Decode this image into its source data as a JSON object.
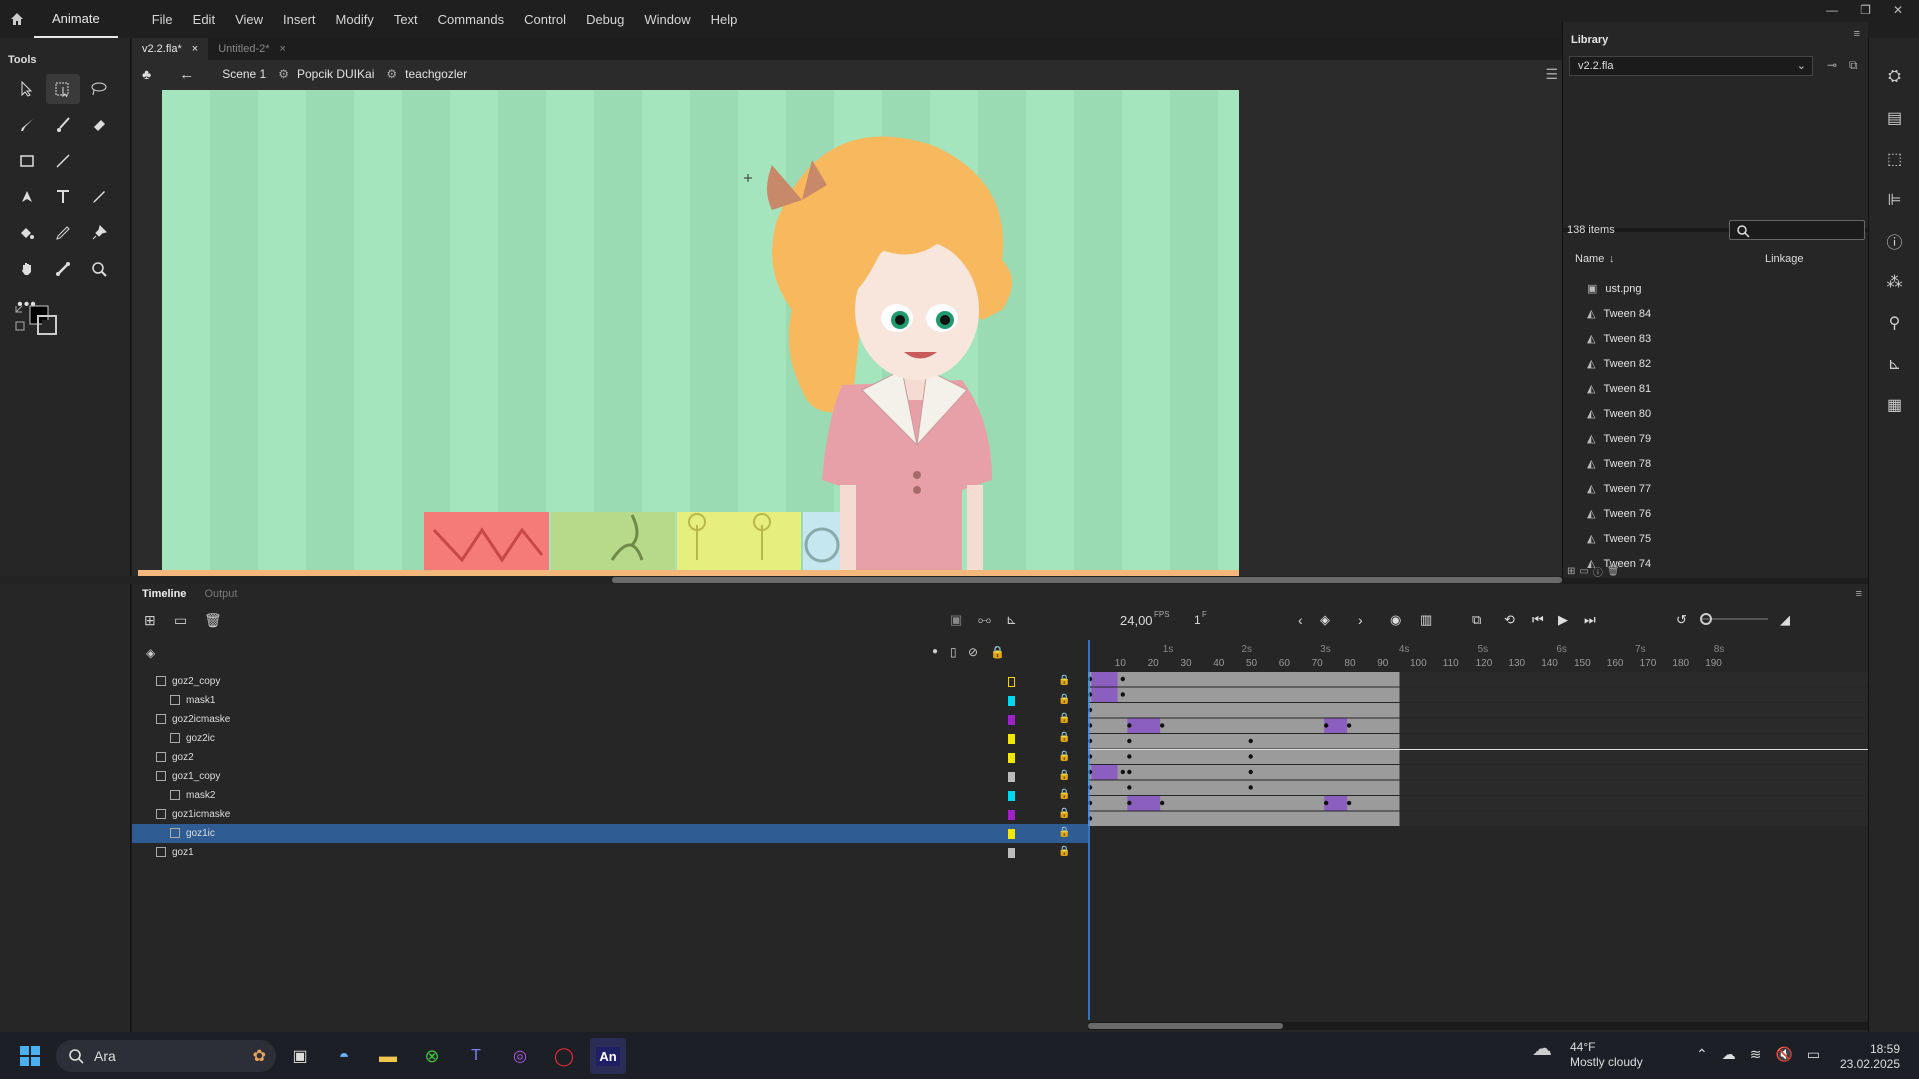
{
  "menubar": {
    "app_name": "Animate",
    "items": [
      "File",
      "Edit",
      "View",
      "Insert",
      "Modify",
      "Text",
      "Commands",
      "Control",
      "Debug",
      "Window",
      "Help"
    ]
  },
  "tools": {
    "title": "Tools"
  },
  "doc_tabs": [
    {
      "label": "v2.2.fla*",
      "active": true
    },
    {
      "label": "Untitled-2*",
      "active": false
    }
  ],
  "breadcrumb": {
    "scene": "Scene 1",
    "symbol1": "Popcik DUIKai",
    "symbol2": "teachgozler"
  },
  "library": {
    "title": "Library",
    "document": "v2.2.fla",
    "count_text": "138 items",
    "col_name": "Name",
    "col_linkage": "Linkage",
    "items": [
      "ust.png",
      "Tween 84",
      "Tween 83",
      "Tween 82",
      "Tween 81",
      "Tween 80",
      "Tween 79",
      "Tween 78",
      "Tween 77",
      "Tween 76",
      "Tween 75",
      "Tween 74"
    ]
  },
  "timeline": {
    "tab_timeline": "Timeline",
    "tab_output": "Output",
    "fps": "24,00",
    "fps_unit": "FPS",
    "current_frame": "1",
    "frame_unit": "F",
    "ruler_frames": [
      "10",
      "20",
      "30",
      "40",
      "50",
      "60",
      "70",
      "80",
      "90",
      "100",
      "110",
      "120",
      "130",
      "140",
      "150",
      "160",
      "170",
      "180",
      "190"
    ],
    "ruler_seconds": [
      "1s",
      "2s",
      "3s",
      "4s",
      "5s",
      "6s",
      "7s",
      "8s"
    ],
    "layers": [
      {
        "name": "goz2_copy",
        "indent": 0,
        "color": "#f0d800",
        "outline": true,
        "selected": false
      },
      {
        "name": "mask1",
        "indent": 1,
        "color": "#00d8f0",
        "selected": false
      },
      {
        "name": "goz2icmaske",
        "indent": 0,
        "color": "#a020c8",
        "selected": false
      },
      {
        "name": "goz2ic",
        "indent": 1,
        "color": "#f0e800",
        "selected": false
      },
      {
        "name": "goz2",
        "indent": 0,
        "color": "#f0e800",
        "selected": false
      },
      {
        "name": "goz1_copy",
        "indent": 0,
        "color": "#bbbbbb",
        "selected": false
      },
      {
        "name": "mask2",
        "indent": 1,
        "color": "#00d8f0",
        "selected": false
      },
      {
        "name": "goz1icmaske",
        "indent": 0,
        "color": "#a020c8",
        "selected": false
      },
      {
        "name": "goz1ic",
        "indent": 1,
        "color": "#f0e800",
        "selected": true
      },
      {
        "name": "goz1",
        "indent": 0,
        "color": "#bbbbbb",
        "selected": false
      }
    ]
  },
  "taskbar": {
    "search_placeholder": "Ara",
    "weather_temp": "44°F",
    "weather_desc": "Mostly cloudy",
    "time": "18:59",
    "date": "23.02.2025"
  }
}
